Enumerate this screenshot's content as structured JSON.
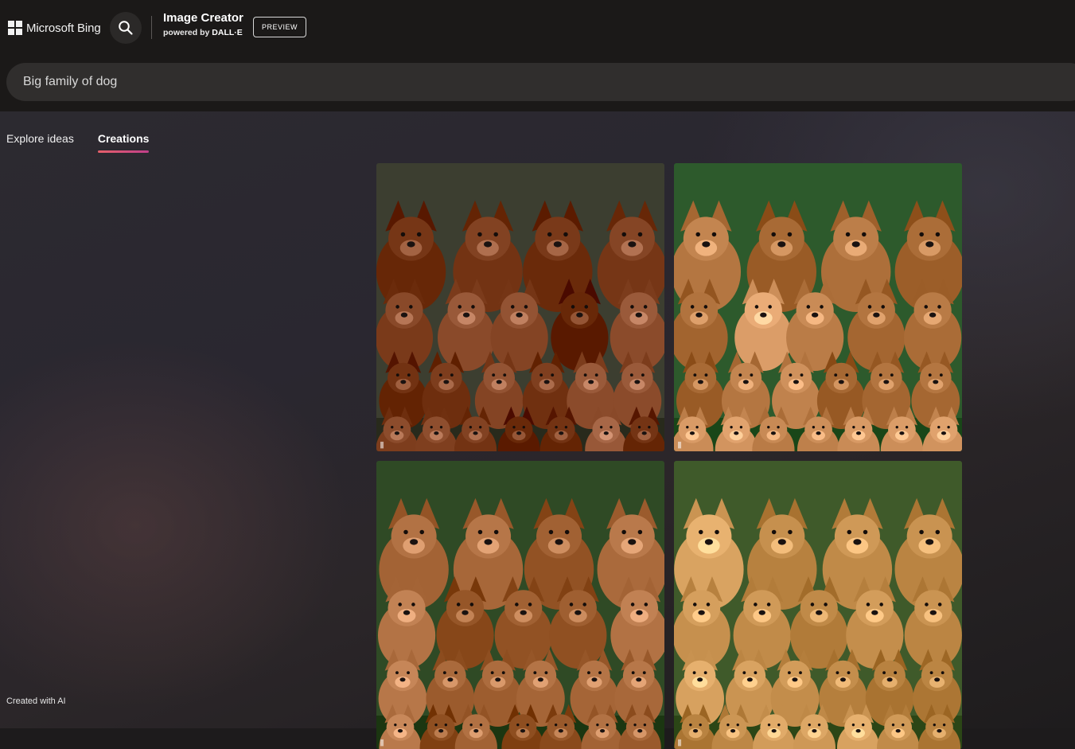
{
  "header": {
    "brand": "Microsoft Bing",
    "title": "Image Creator",
    "subtitle_prefix": "powered by",
    "subtitle_brand": "DALL·E",
    "badge": "PREVIEW"
  },
  "prompt": {
    "value": "Big family of dog"
  },
  "tabs": [
    {
      "label": "Explore ideas",
      "active": false
    },
    {
      "label": "Creations",
      "active": true
    }
  ],
  "images": [
    {
      "bg": "#3c3e30",
      "fur": "#8a4a2a"
    },
    {
      "bg": "#2d5a2c",
      "fur": "#c88a55"
    },
    {
      "bg": "#2f4a25",
      "fur": "#a8683a"
    },
    {
      "bg": "#3f5a2a",
      "fur": "#d09a58"
    }
  ],
  "footer": {
    "note": "Created with AI"
  },
  "colors": {
    "accent_start": "#e6606a",
    "accent_end": "#c13f8a",
    "header_bg": "#1b1918"
  }
}
